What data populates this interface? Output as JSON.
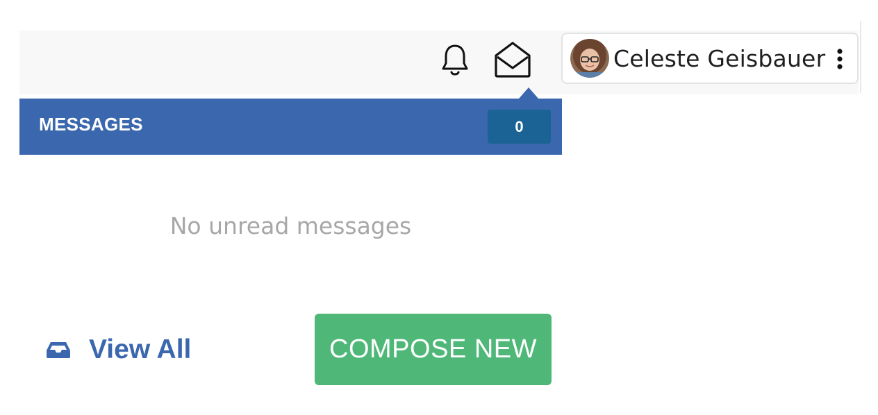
{
  "user": {
    "name": "Celeste Geisbauer",
    "avatar_icon": "user-avatar"
  },
  "header_icons": {
    "notifications": "bell-icon",
    "messages": "envelope-open-icon",
    "user_menu": "vertical-ellipsis-icon"
  },
  "messages_dropdown": {
    "title": "MESSAGES",
    "count": "0",
    "empty_text": "No unread messages",
    "view_all_label": "View All",
    "view_all_icon": "inbox-tray-icon",
    "compose_label": "COMPOSE NEW"
  },
  "colors": {
    "header_blue": "#3a67ae",
    "badge_blue": "#1a6394",
    "compose_green": "#4fb878",
    "empty_text_gray": "#a7a7a7"
  }
}
